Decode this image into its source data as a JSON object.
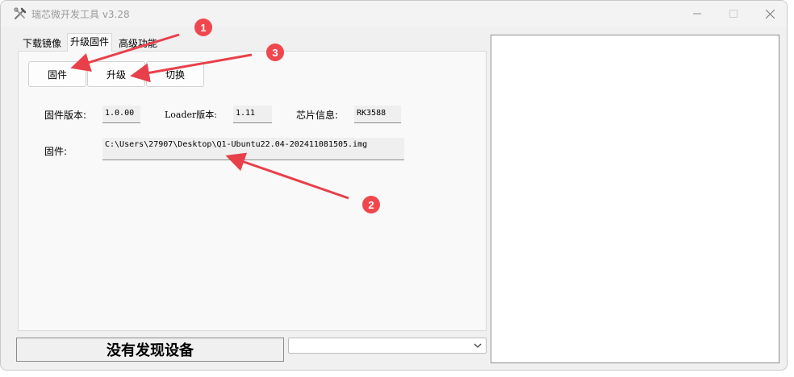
{
  "window": {
    "title": "瑞芯微开发工具 v3.28"
  },
  "tabs": [
    {
      "label": "下载镜像"
    },
    {
      "label": "升级固件"
    },
    {
      "label": "高级功能"
    }
  ],
  "buttons": {
    "firmware": "固件",
    "upgrade": "升级",
    "switch": "切换"
  },
  "info": {
    "firmware_version_label": "固件版本:",
    "firmware_version": "1.0.00",
    "loader_version_label": "Loader版本:",
    "loader_version": "1.11",
    "chip_info_label": "芯片信息:",
    "chip_info": "RK3588",
    "firmware_path_label": "固件:",
    "firmware_path": "C:\\Users\\27907\\Desktop\\Q1-Ubuntu22.04-202411081505.img"
  },
  "status": {
    "device_text": "没有发现设备",
    "device_select_value": ""
  },
  "annotations": {
    "callout_1": "1",
    "callout_2": "2",
    "callout_3": "3"
  },
  "colors": {
    "callout": "#f0474e",
    "arrow": "#e8404a"
  },
  "icons": {
    "app": "tools-icon",
    "minimize": "minimize-icon",
    "maximize": "maximize-icon",
    "close": "close-icon",
    "dropdown": "chevron-down-icon"
  }
}
